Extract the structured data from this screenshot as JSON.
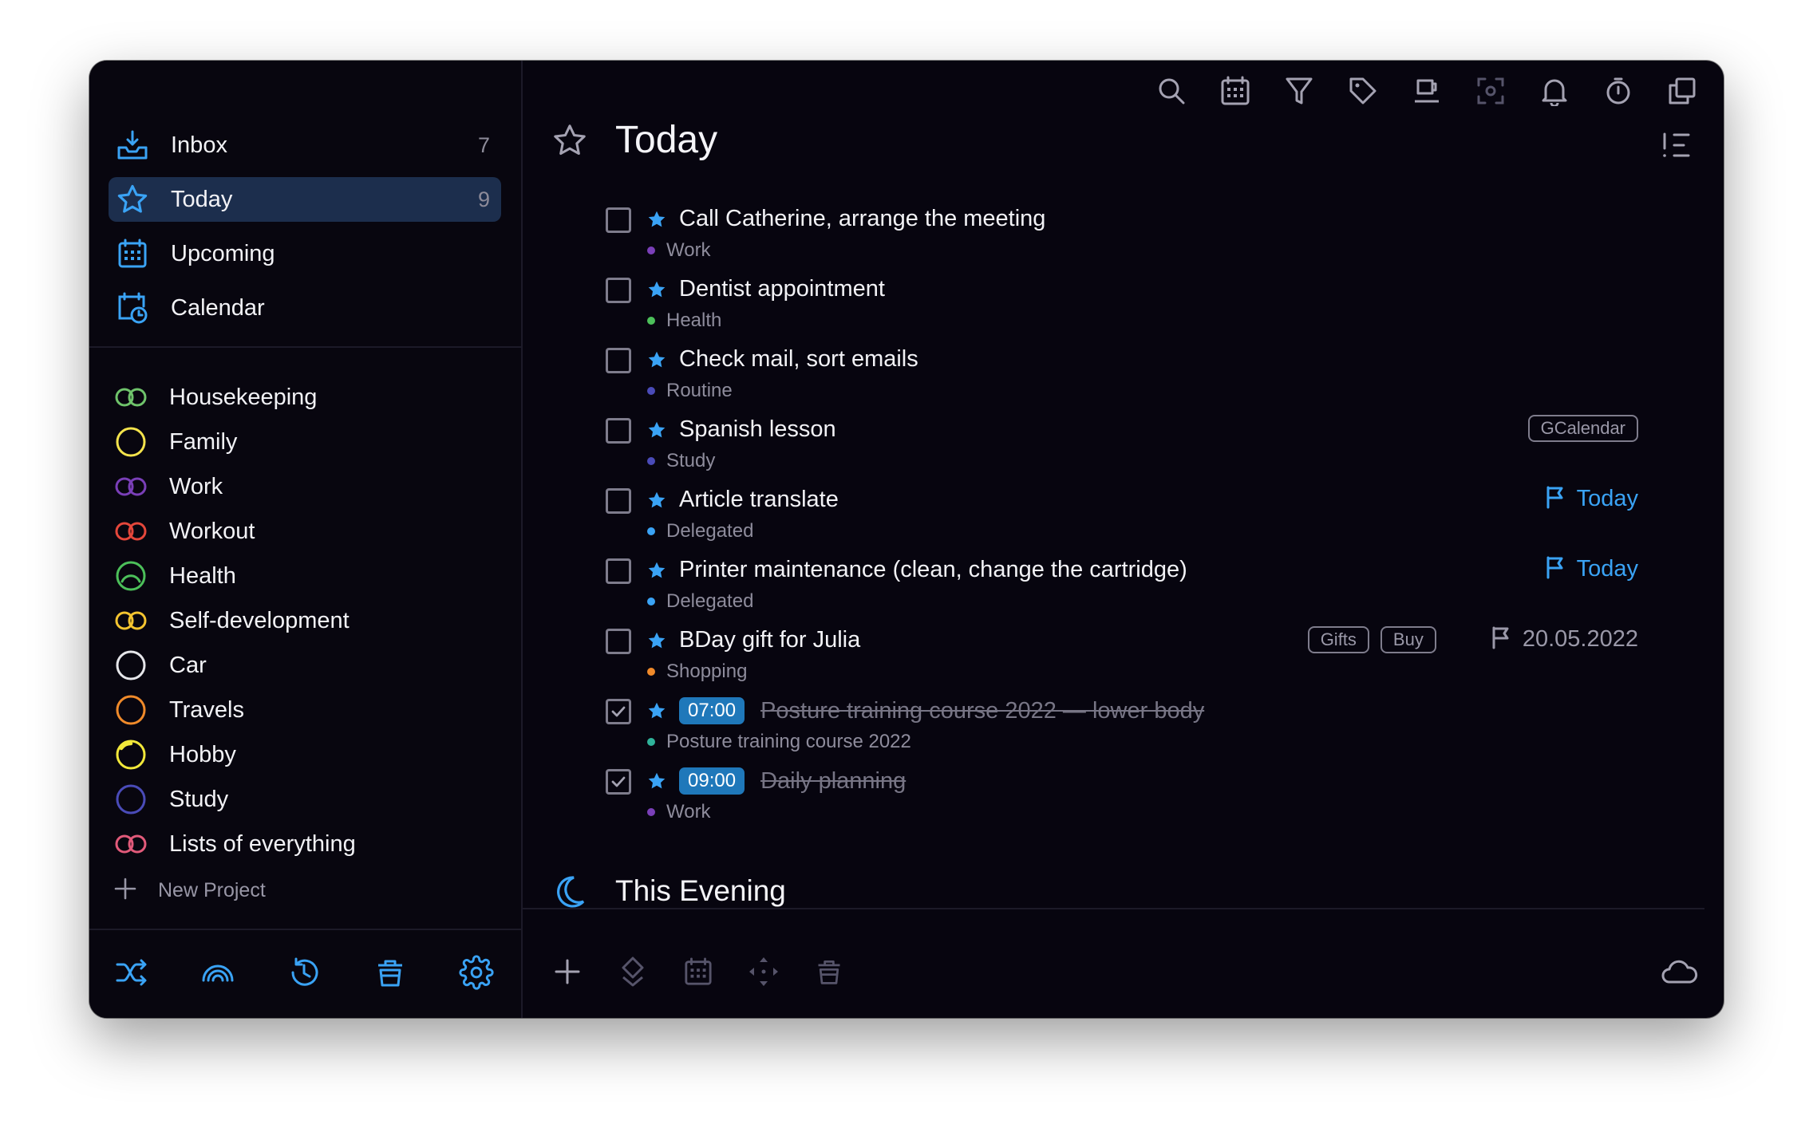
{
  "colors": {
    "accent": "#3aa3f5",
    "window_bg": "#07050f",
    "selected_bg": "#1c2e4d",
    "time_badge": "#1f78ba"
  },
  "sidebar": {
    "smart_lists": [
      {
        "label": "Inbox",
        "count": "7",
        "icon": "inbox-icon"
      },
      {
        "label": "Today",
        "count": "9",
        "icon": "star-icon",
        "selected": true
      },
      {
        "label": "Upcoming",
        "count": "",
        "icon": "calendar-grid-icon"
      },
      {
        "label": "Calendar",
        "count": "",
        "icon": "calendar-clock-icon"
      }
    ],
    "projects": [
      {
        "label": "Housekeeping",
        "color": "#6fc36b"
      },
      {
        "label": "Family",
        "color": "#f4e34c"
      },
      {
        "label": "Work",
        "color": "#7a3fb8"
      },
      {
        "label": "Workout",
        "color": "#e5473b"
      },
      {
        "label": "Health",
        "color": "#4cc05a"
      },
      {
        "label": "Self-development",
        "color": "#f4c430"
      },
      {
        "label": "Car",
        "color": "#e6e6ea"
      },
      {
        "label": "Travels",
        "color": "#f08a2a"
      },
      {
        "label": "Hobby",
        "color": "#f2e83a"
      },
      {
        "label": "Study",
        "color": "#4a4bb8"
      },
      {
        "label": "Lists of everything",
        "color": "#e25a7a"
      }
    ],
    "new_project_label": "New Project",
    "toolbar": [
      "shuffle-icon",
      "rainbow-icon",
      "history-icon",
      "trash-icon",
      "settings-icon"
    ]
  },
  "main": {
    "toolbar": [
      "search-icon",
      "calendar-icon",
      "filter-icon",
      "tag-icon",
      "coffee-icon",
      "focus-icon",
      "bell-icon",
      "timer-icon",
      "copy-icon"
    ],
    "today_title": "Today",
    "evening_title": "This Evening",
    "tasks": [
      {
        "title": "Call Catherine, arrange the meeting",
        "project": "Work",
        "dot": "#7a3fb8",
        "done": false
      },
      {
        "title": "Dentist appointment",
        "project": "Health",
        "dot": "#4cc05a",
        "done": false
      },
      {
        "title": "Check mail, sort emails",
        "project": "Routine",
        "dot": "#4a4bb8",
        "done": false
      },
      {
        "title": "Spanish lesson",
        "project": "Study",
        "dot": "#4a4bb8",
        "done": false,
        "tags": [
          "GCalendar"
        ]
      },
      {
        "title": "Article translate",
        "project": "Delegated",
        "dot": "#3aa3f5",
        "done": false,
        "flag": "Today",
        "flag_color": "#3aa3f5"
      },
      {
        "title": "Printer maintenance (clean, change the cartridge)",
        "project": "Delegated",
        "dot": "#3aa3f5",
        "done": false,
        "flag": "Today",
        "flag_color": "#3aa3f5"
      },
      {
        "title": "BDay gift for Julia",
        "project": "Shopping",
        "dot": "#f08a2a",
        "done": false,
        "tags": [
          "Gifts",
          "Buy"
        ],
        "flag": "20.05.2022",
        "flag_color": "#9a98a8"
      },
      {
        "title": "Posture training course 2022 — lower body",
        "project": "Posture training course 2022",
        "dot": "#2fb39a",
        "done": true,
        "time": "07:00"
      },
      {
        "title": "Daily planning",
        "project": "Work",
        "dot": "#7a3fb8",
        "done": true,
        "time": "09:00"
      }
    ],
    "bottom_toolbar": [
      "add-icon",
      "priority-icon",
      "calendar-icon",
      "move-icon",
      "trash-icon"
    ],
    "cloud_icon": "cloud-icon"
  }
}
